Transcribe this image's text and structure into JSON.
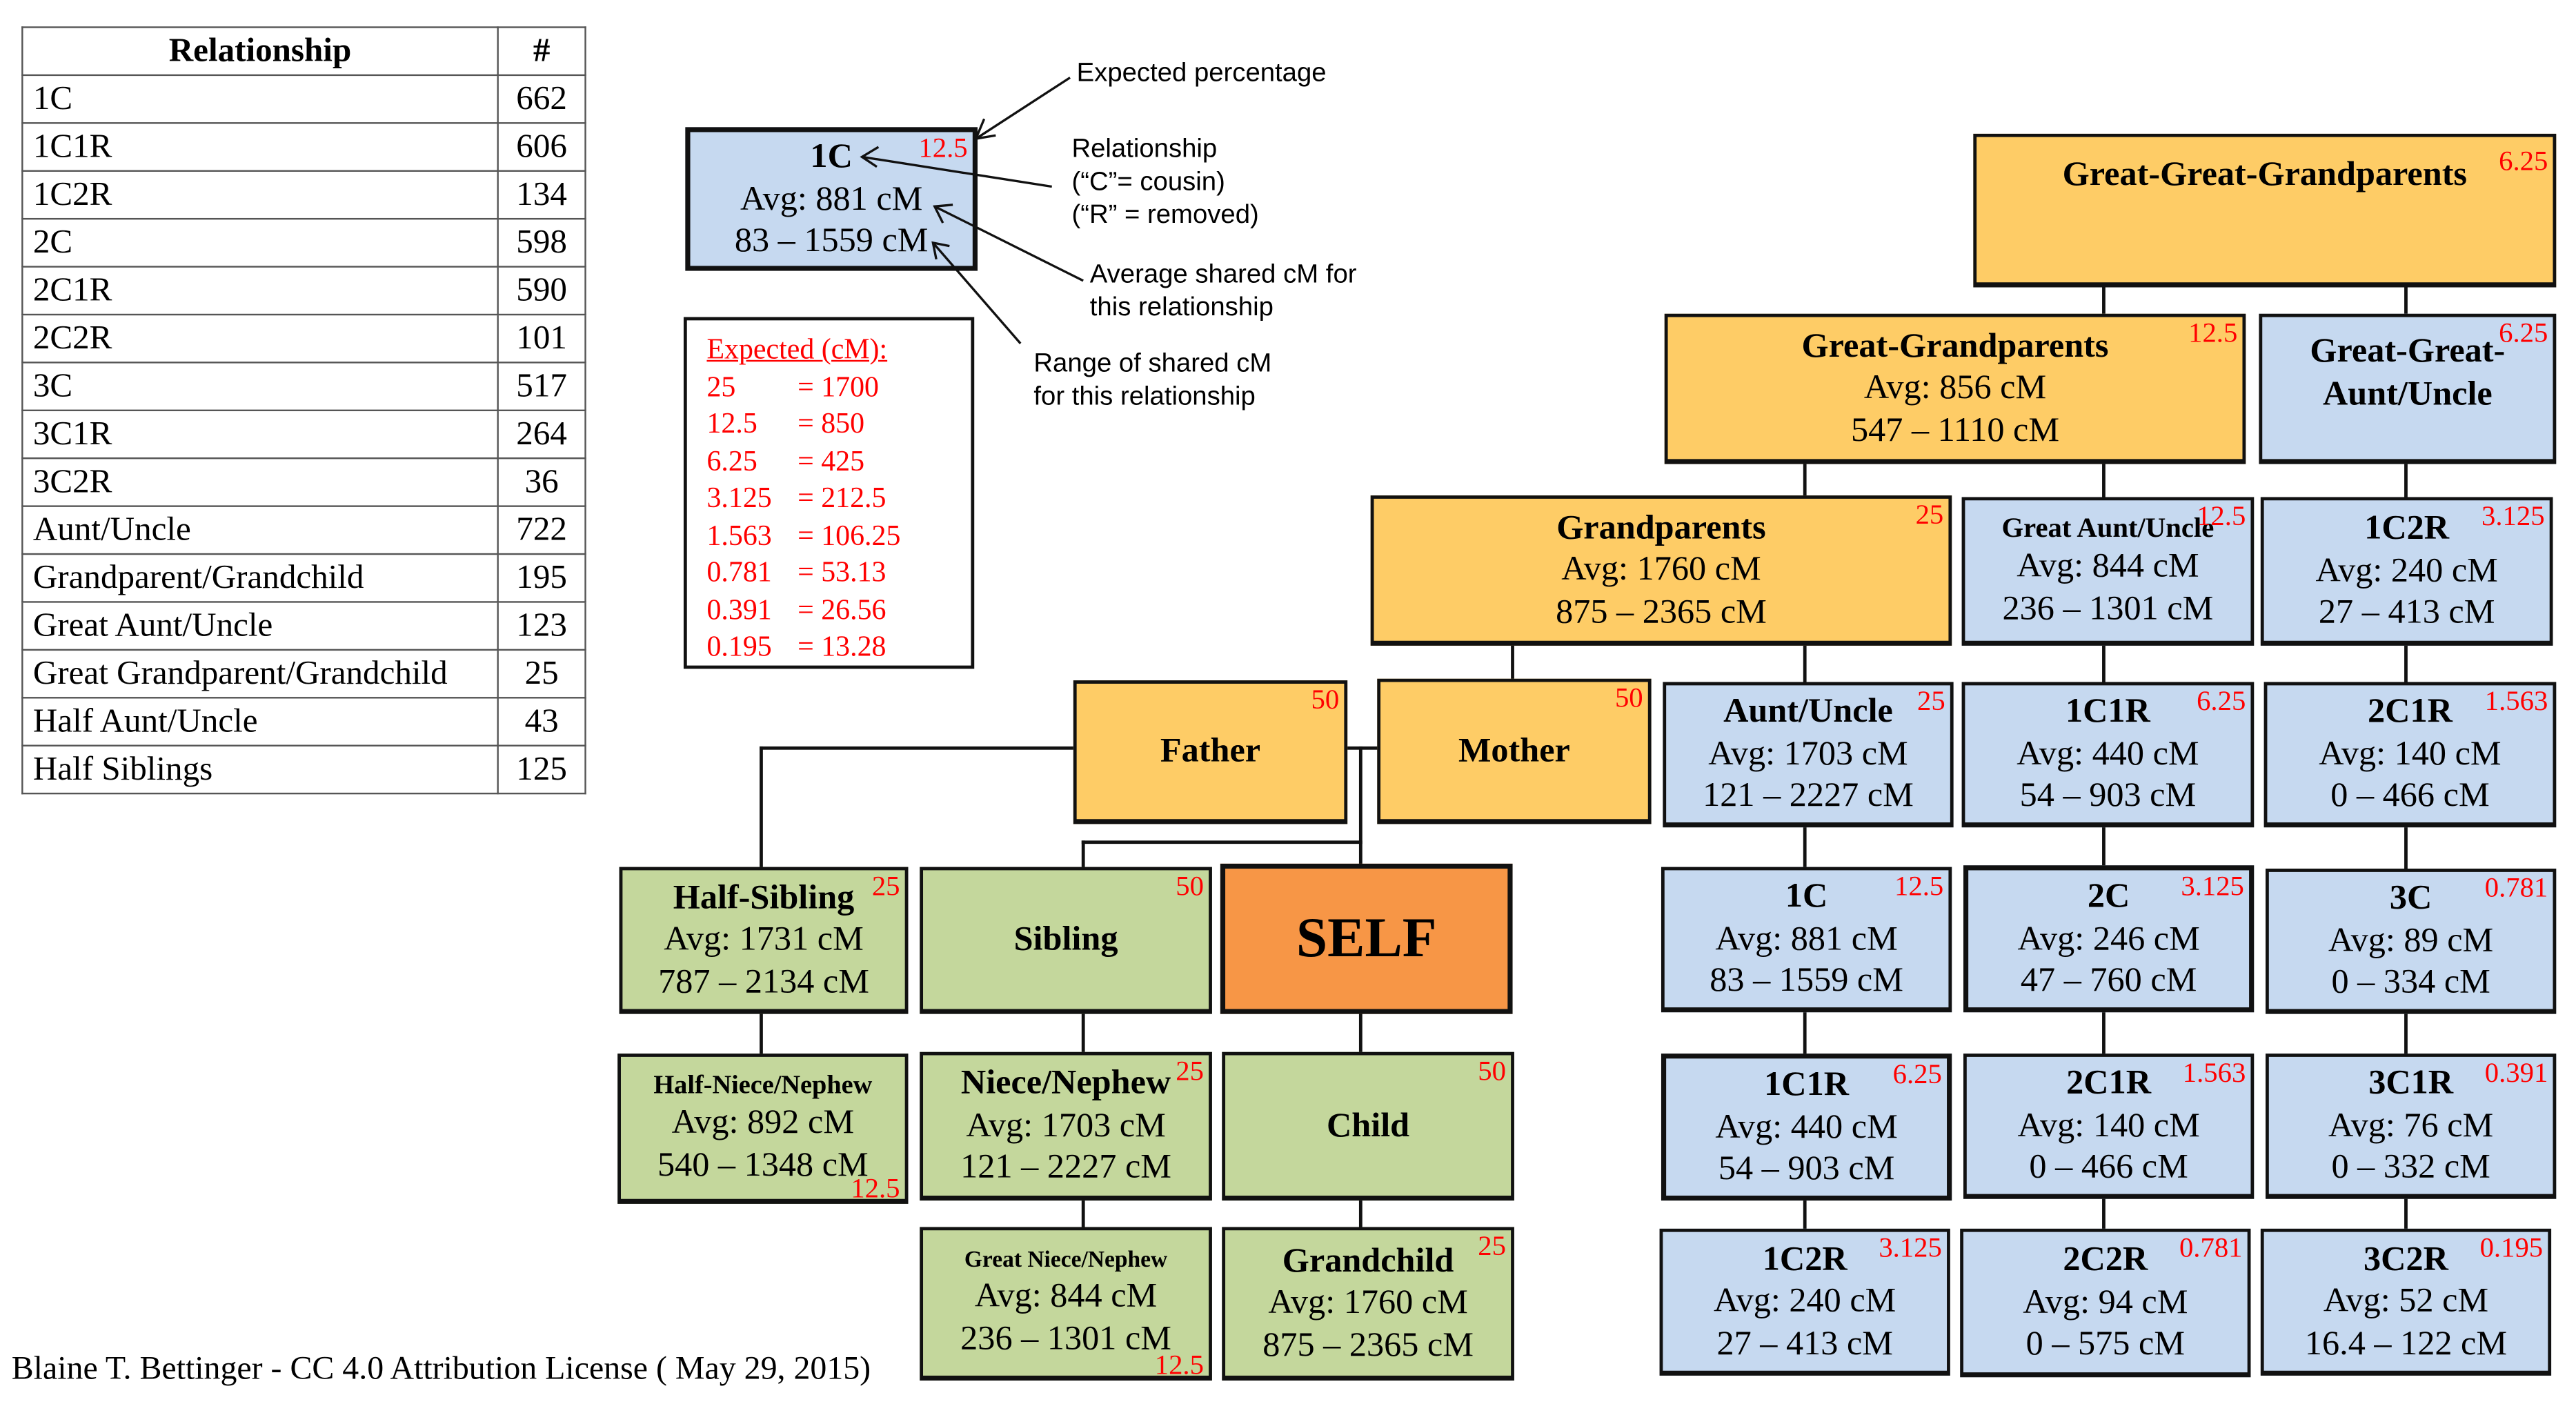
{
  "stats_table": {
    "headers": [
      "Relationship",
      "#"
    ],
    "rows": [
      {
        "relationship": "1C",
        "count": "662"
      },
      {
        "relationship": "1C1R",
        "count": "606"
      },
      {
        "relationship": "1C2R",
        "count": "134"
      },
      {
        "relationship": "2C",
        "count": "598"
      },
      {
        "relationship": "2C1R",
        "count": "590"
      },
      {
        "relationship": "2C2R",
        "count": "101"
      },
      {
        "relationship": "3C",
        "count": "517"
      },
      {
        "relationship": "3C1R",
        "count": "264"
      },
      {
        "relationship": "3C2R",
        "count": "36"
      },
      {
        "relationship": "Aunt/Uncle",
        "count": "722"
      },
      {
        "relationship": "Grandparent/Grandchild",
        "count": "195"
      },
      {
        "relationship": "Great Aunt/Uncle",
        "count": "123"
      },
      {
        "relationship": "Great Grandparent/Grandchild",
        "count": "25"
      },
      {
        "relationship": "Half Aunt/Uncle",
        "count": "43"
      },
      {
        "relationship": "Half Siblings",
        "count": "125"
      }
    ]
  },
  "legend": {
    "sample": {
      "name": "1C",
      "avg": "Avg: 881 cM",
      "range": "83 – 1559 cM",
      "pct": "12.5"
    },
    "notes": {
      "expected_pct": "Expected percentage",
      "relationship_1": "Relationship",
      "relationship_2": "(“C”= cousin)",
      "relationship_3": "(“R” = removed)",
      "avg_1": "Average shared cM for",
      "avg_2": "this relationship",
      "range_1": "Range of shared cM",
      "range_2": "for this relationship"
    },
    "expected": {
      "title": "Expected (cM):",
      "rows": [
        {
          "pct": "25",
          "cm": "= 1700"
        },
        {
          "pct": "12.5",
          "cm": "= 850"
        },
        {
          "pct": "6.25",
          "cm": "= 425"
        },
        {
          "pct": "3.125",
          "cm": "= 212.5"
        },
        {
          "pct": "1.563",
          "cm": "= 106.25"
        },
        {
          "pct": "0.781",
          "cm": "= 53.13"
        },
        {
          "pct": "0.391",
          "cm": "= 26.56"
        },
        {
          "pct": "0.195",
          "cm": "= 13.28"
        }
      ]
    }
  },
  "nodes": {
    "ggg": {
      "name": "Great-Great-Grandparents",
      "pct": "6.25"
    },
    "gg": {
      "name": "Great-Grandparents",
      "avg": "Avg: 856 cM",
      "range": "547 – 1110 cM",
      "pct": "12.5"
    },
    "ggau": {
      "name": "Great-Great-Aunt/Uncle",
      "pct": "6.25"
    },
    "gp": {
      "name": "Grandparents",
      "avg": "Avg: 1760 cM",
      "range": "875 – 2365 cM",
      "pct": "25"
    },
    "gau": {
      "name": "Great Aunt/Uncle",
      "avg": "Avg: 844 cM",
      "range": "236 – 1301 cM",
      "pct": "12.5"
    },
    "c1c2r_top": {
      "name": "1C2R",
      "avg": "Avg: 240 cM",
      "range": "27 – 413 cM",
      "pct": "3.125"
    },
    "father": {
      "name": "Father",
      "pct": "50"
    },
    "mother": {
      "name": "Mother",
      "pct": "50"
    },
    "au": {
      "name": "Aunt/Uncle",
      "avg": "Avg: 1703 cM",
      "range": "121 – 2227 cM",
      "pct": "25"
    },
    "c1c1r_top": {
      "name": "1C1R",
      "avg": "Avg: 440 cM",
      "range": "54 – 903 cM",
      "pct": "6.25"
    },
    "c2c1r_top": {
      "name": "2C1R",
      "avg": "Avg: 140 cM",
      "range": "0 – 466 cM",
      "pct": "1.563"
    },
    "halfsib": {
      "name": "Half-Sibling",
      "avg": "Avg: 1731 cM",
      "range": "787 – 2134 cM",
      "pct": "25"
    },
    "sibling": {
      "name": "Sibling",
      "pct": "50"
    },
    "self": {
      "name": "SELF"
    },
    "c1c": {
      "name": "1C",
      "avg": "Avg: 881 cM",
      "range": "83 – 1559 cM",
      "pct": "12.5"
    },
    "c2c": {
      "name": "2C",
      "avg": "Avg: 246 cM",
      "range": "47 – 760 cM",
      "pct": "3.125"
    },
    "c3c": {
      "name": "3C",
      "avg": "Avg: 89 cM",
      "range": "0 – 334 cM",
      "pct": "0.781"
    },
    "halfnn": {
      "name": "Half-Niece/Nephew",
      "avg": "Avg: 892 cM",
      "range": "540 – 1348 cM",
      "pct": "12.5"
    },
    "nn": {
      "name": "Niece/Nephew",
      "avg": "Avg: 1703 cM",
      "range": "121 – 2227 cM",
      "pct": "25"
    },
    "child": {
      "name": "Child",
      "pct": "50"
    },
    "c1c1r": {
      "name": "1C1R",
      "avg": "Avg: 440 cM",
      "range": "54 – 903 cM",
      "pct": "6.25"
    },
    "c2c1r": {
      "name": "2C1R",
      "avg": "Avg: 140 cM",
      "range": "0 – 466 cM",
      "pct": "1.563"
    },
    "c3c1r": {
      "name": "3C1R",
      "avg": "Avg: 76 cM",
      "range": "0 – 332 cM",
      "pct": "0.391"
    },
    "gnn": {
      "name": "Great Niece/Nephew",
      "avg": "Avg: 844 cM",
      "range": "236 – 1301 cM",
      "pct": "12.5"
    },
    "grandchild": {
      "name": "Grandchild",
      "avg": "Avg: 1760 cM",
      "range": "875 – 2365 cM",
      "pct": "25"
    },
    "c1c2r": {
      "name": "1C2R",
      "avg": "Avg: 240 cM",
      "range": "27 – 413 cM",
      "pct": "3.125"
    },
    "c2c2r": {
      "name": "2C2R",
      "avg": "Avg: 94 cM",
      "range": "0 – 575 cM",
      "pct": "0.781"
    },
    "c3c2r": {
      "name": "3C2R",
      "avg": "Avg: 52 cM",
      "range": "16.4 – 122 cM",
      "pct": "0.195"
    }
  },
  "colors": {
    "ancestor": "#fecc66",
    "collateral": "#c6d9f0",
    "descendant": "#c4d79c",
    "self": "#f79646",
    "percent_text": "#ff0000"
  },
  "credit": "Blaine T. Bettinger - CC 4.0 Attribution License ( May 29, 2015)"
}
